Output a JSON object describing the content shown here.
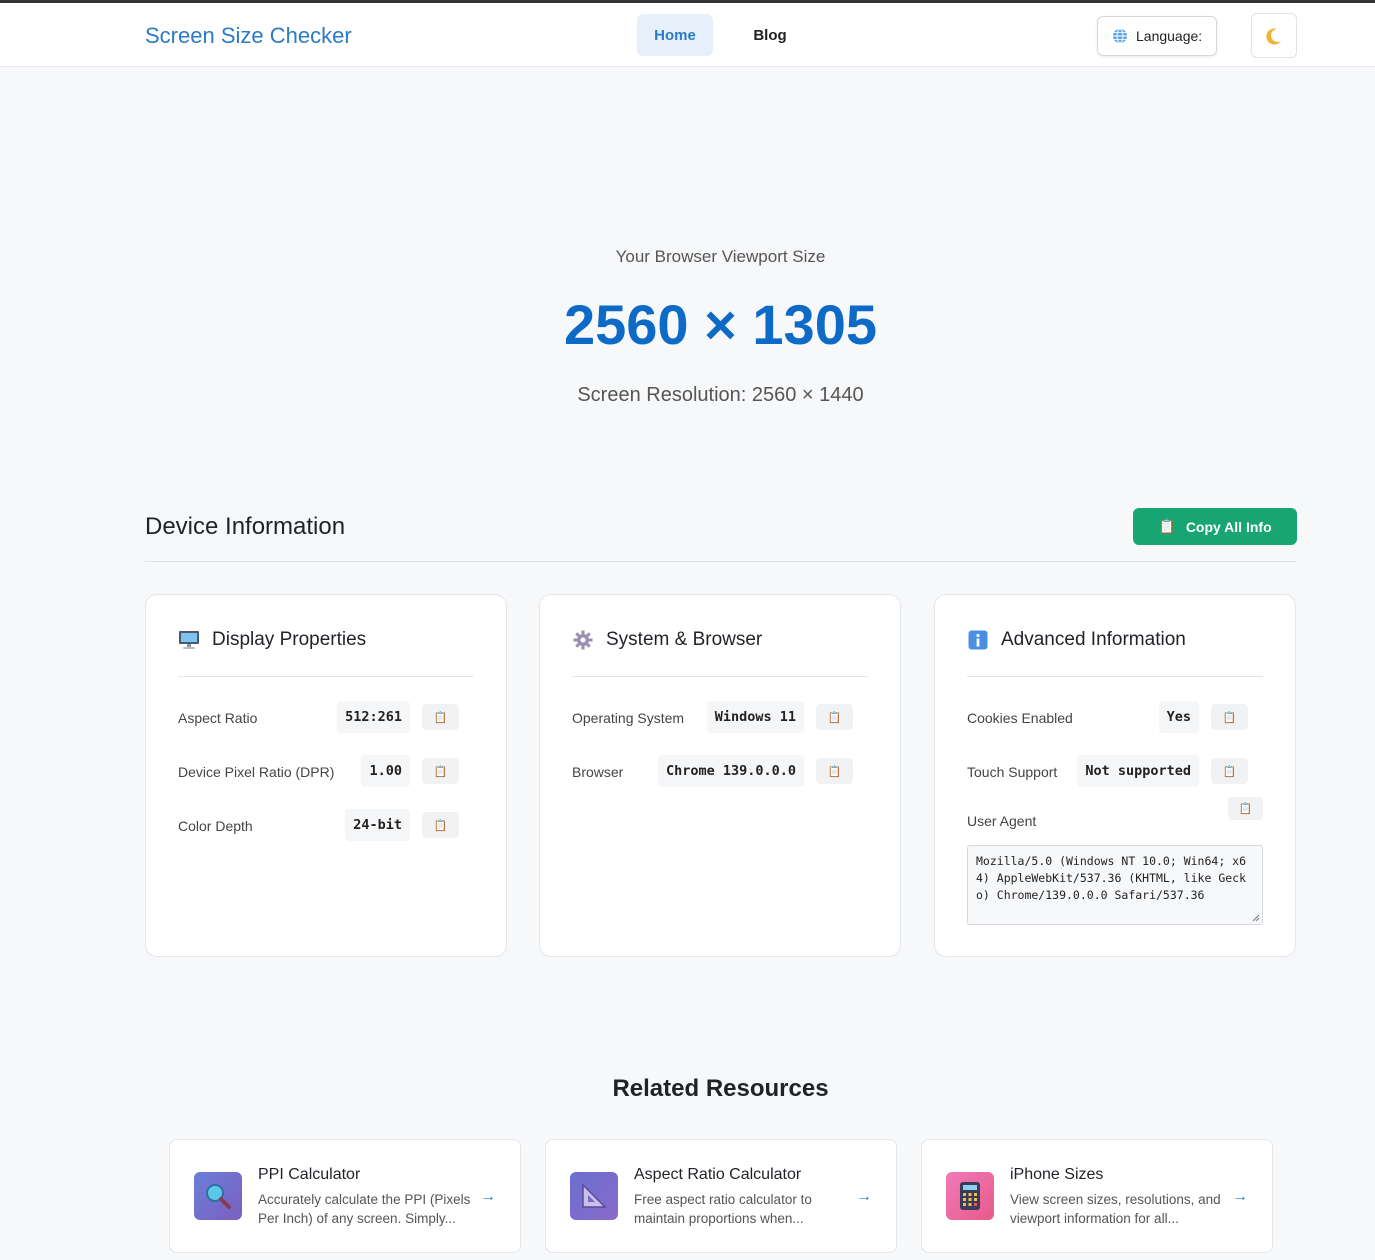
{
  "header": {
    "brand": "Screen Size Checker",
    "nav": [
      {
        "label": "Home",
        "active": true
      },
      {
        "label": "Blog",
        "active": false
      }
    ],
    "language_label": "Language:",
    "theme_icon": "moon-icon"
  },
  "hero": {
    "subtitle": "Your Browser Viewport Size",
    "viewport": "2560 × 1305",
    "resolution": "Screen Resolution: 2560 × 1440"
  },
  "device_info": {
    "title": "Device Information",
    "copy_all": "Copy All Info",
    "cards": [
      {
        "title": "Display Properties",
        "icon": "monitor-icon",
        "rows": [
          {
            "label": "Aspect Ratio",
            "value": "512:261"
          },
          {
            "label": "Device Pixel Ratio (DPR)",
            "value": "1.00"
          },
          {
            "label": "Color Depth",
            "value": "24-bit"
          }
        ]
      },
      {
        "title": "System & Browser",
        "icon": "gear-icon",
        "rows": [
          {
            "label": "Operating System",
            "value": "Windows 11"
          },
          {
            "label": "Browser",
            "value": "Chrome 139.0.0.0"
          }
        ]
      },
      {
        "title": "Advanced Information",
        "icon": "info-icon",
        "rows": [
          {
            "label": "Cookies Enabled",
            "value": "Yes"
          },
          {
            "label": "Touch Support",
            "value": "Not supported"
          }
        ],
        "user_agent_label": "User Agent",
        "user_agent": "Mozilla/5.0 (Windows NT 10.0; Win64; x64) AppleWebKit/537.36 (KHTML, like Gecko) Chrome/139.0.0.0 Safari/537.36"
      }
    ]
  },
  "related": {
    "title": "Related Resources",
    "items": [
      {
        "title": "PPI Calculator",
        "desc": "Accurately calculate the PPI (Pixels Per Inch) of any screen. Simply...",
        "icon": "magnifier-icon"
      },
      {
        "title": "Aspect Ratio Calculator",
        "desc": "Free aspect ratio calculator to maintain proportions when...",
        "icon": "triangle-ruler-icon"
      },
      {
        "title": "iPhone Sizes",
        "desc": "View screen sizes, resolutions, and viewport information for all...",
        "icon": "calculator-icon"
      }
    ]
  }
}
